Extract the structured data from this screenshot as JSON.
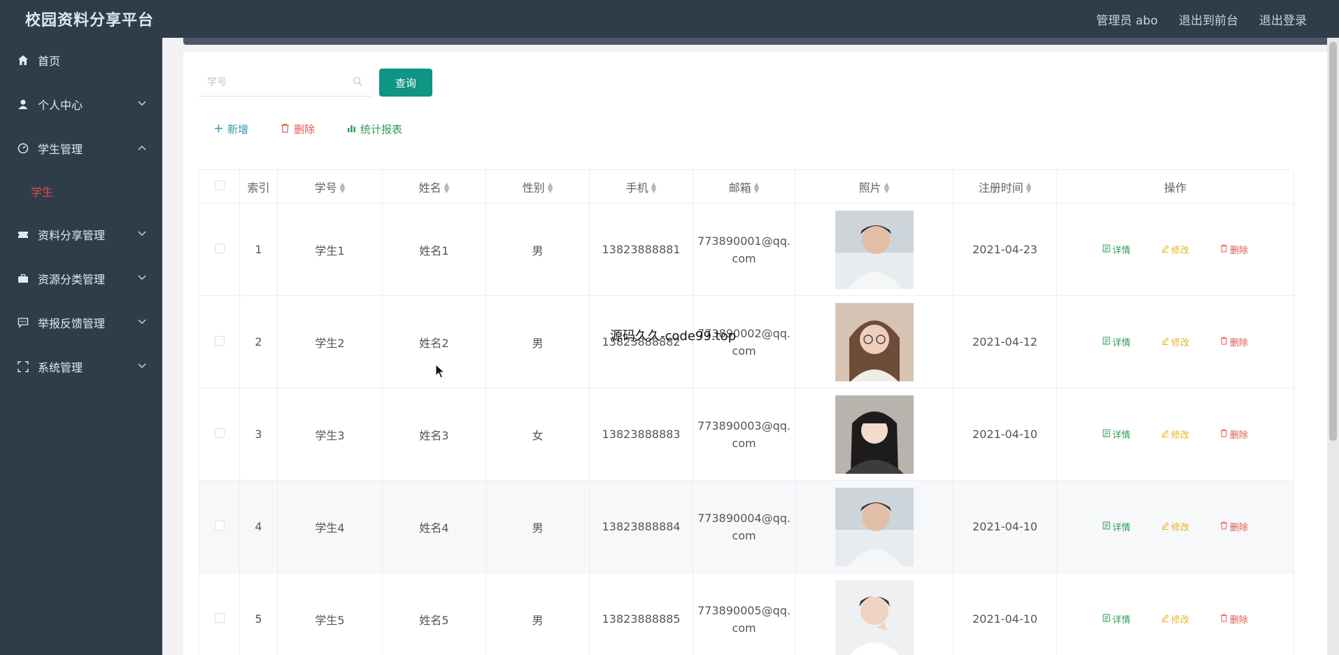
{
  "header": {
    "brand": "校园资料分享平台",
    "admin": "管理员 abo",
    "to_front": "退出到前台",
    "logout": "退出登录"
  },
  "sidebar": {
    "items": [
      {
        "label": "首页",
        "icon": "home-icon"
      },
      {
        "label": "个人中心",
        "icon": "user-icon"
      },
      {
        "label": "学生管理",
        "icon": "gauge-icon",
        "expanded": true
      },
      {
        "label": "资料分享管理",
        "icon": "ticket-icon"
      },
      {
        "label": "资源分类管理",
        "icon": "briefcase-icon"
      },
      {
        "label": "举报反馈管理",
        "icon": "chat-icon"
      },
      {
        "label": "系统管理",
        "icon": "expand-icon"
      }
    ],
    "sub_items": [
      {
        "label": "学生"
      }
    ]
  },
  "search": {
    "placeholder": "学号",
    "button": "查询"
  },
  "actions": {
    "add": "新增",
    "delete": "删除",
    "stats": "统计报表"
  },
  "table": {
    "headers": [
      "索引",
      "学号",
      "姓名",
      "性别",
      "手机",
      "邮箱",
      "照片",
      "注册时间",
      "操作"
    ],
    "op_labels": {
      "detail": "详情",
      "edit": "修改",
      "delete": "删除"
    },
    "rows": [
      {
        "index": "1",
        "student_no": "学生1",
        "name": "姓名1",
        "gender": "男",
        "phone": "13823888881",
        "email_a": "773890001@qq.",
        "email_b": "com",
        "date": "2021-04-23"
      },
      {
        "index": "2",
        "student_no": "学生2",
        "name": "姓名2",
        "gender": "男",
        "phone": "13823888882",
        "email_a": "773890002@qq.",
        "email_b": "com",
        "date": "2021-04-12"
      },
      {
        "index": "3",
        "student_no": "学生3",
        "name": "姓名3",
        "gender": "女",
        "phone": "13823888883",
        "email_a": "773890003@qq.",
        "email_b": "com",
        "date": "2021-04-10"
      },
      {
        "index": "4",
        "student_no": "学生4",
        "name": "姓名4",
        "gender": "男",
        "phone": "13823888884",
        "email_a": "773890004@qq.",
        "email_b": "com",
        "date": "2021-04-10"
      },
      {
        "index": "5",
        "student_no": "学生5",
        "name": "姓名5",
        "gender": "男",
        "phone": "13823888885",
        "email_a": "773890005@qq.",
        "email_b": "com",
        "date": "2021-04-10"
      }
    ]
  },
  "overlay": "源码久久-code99.top",
  "colors": {
    "sidebar_bg": "#2f3d4b",
    "primary": "#109483",
    "danger": "#e0574f",
    "warning": "#e6b422",
    "success": "#2f9a5a"
  }
}
